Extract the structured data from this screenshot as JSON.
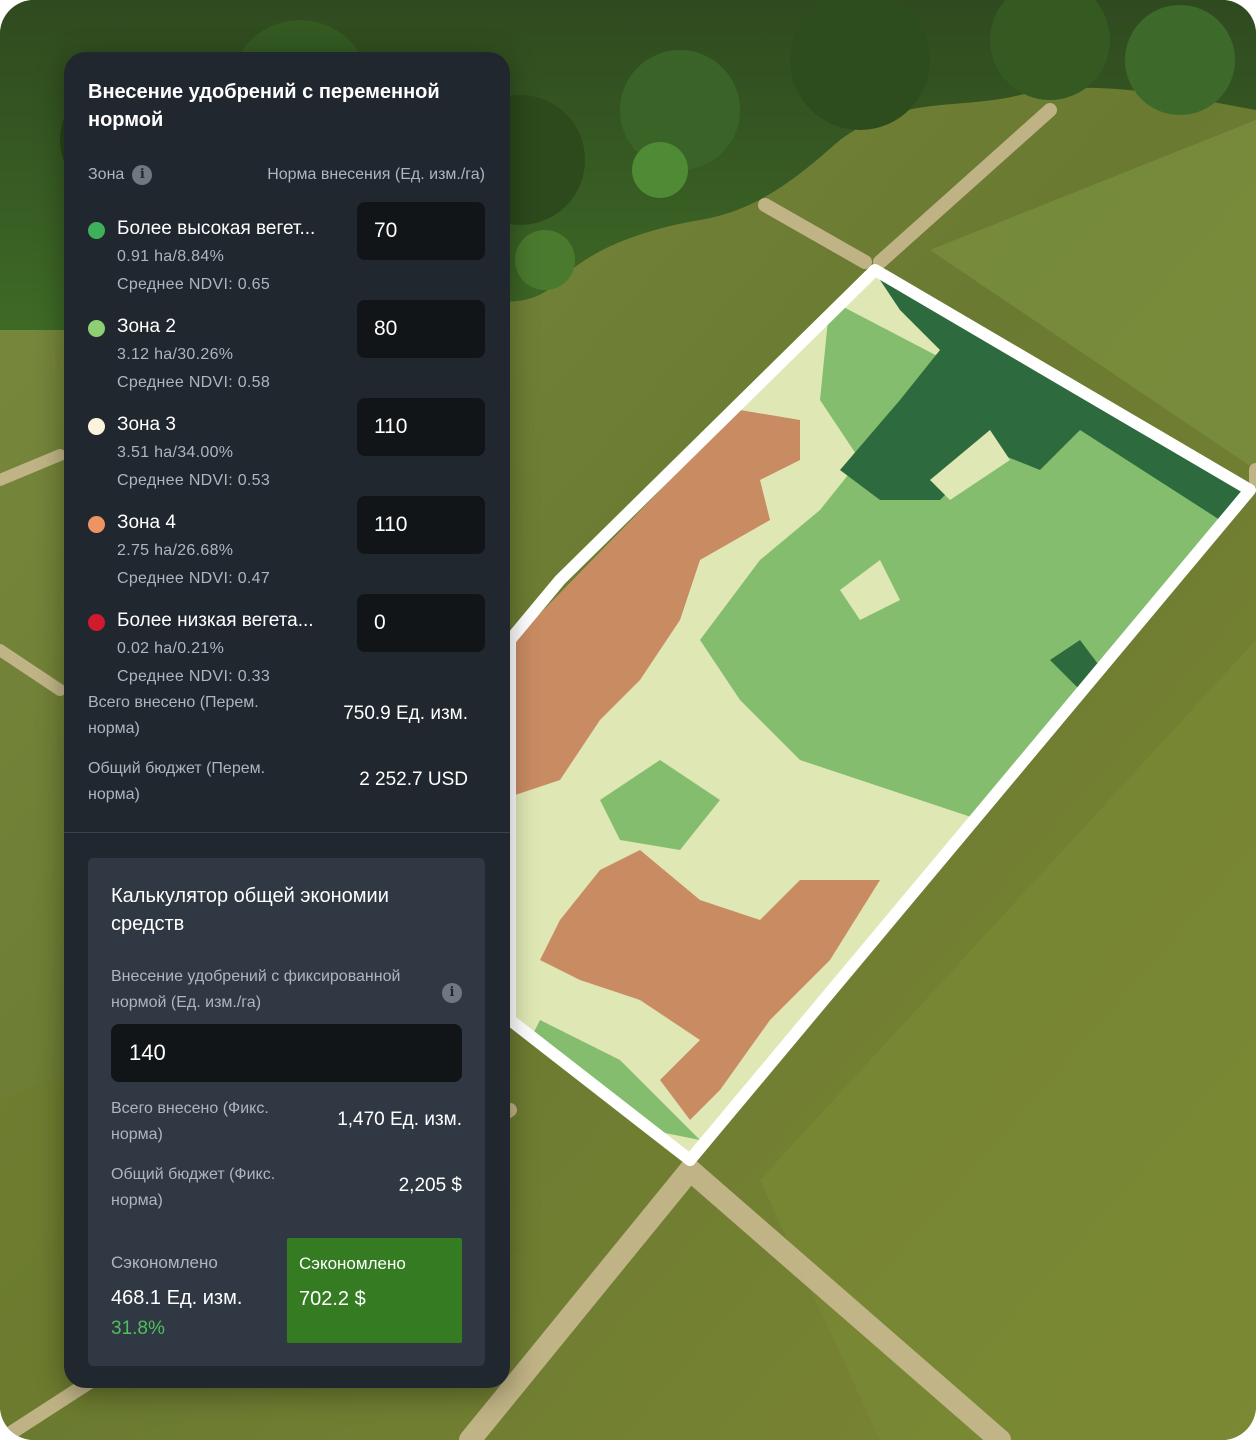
{
  "panel": {
    "title": "Внесение удобрений с переменной нормой",
    "zone_header": "Зона",
    "rate_header": "Норма внесения (Ед. изм./га)",
    "zones": [
      {
        "name": "Более высокая вегет...",
        "area": "0.91 ha/8.84%",
        "ndvi": "Среднее NDVI: 0.65",
        "rate": "70",
        "color": "#3fb05a"
      },
      {
        "name": "Зона 2",
        "area": "3.12 ha/30.26%",
        "ndvi": "Среднее NDVI: 0.58",
        "rate": "80",
        "color": "#8fcf73"
      },
      {
        "name": "Зона 3",
        "area": "3.51 ha/34.00%",
        "ndvi": "Среднее NDVI: 0.53",
        "rate": "110",
        "color": "#fbf3dc"
      },
      {
        "name": "Зона 4",
        "area": "2.75 ha/26.68%",
        "ndvi": "Среднее NDVI: 0.47",
        "rate": "110",
        "color": "#ec9563"
      },
      {
        "name": "Более низкая вегета...",
        "area": "0.02 ha/0.21%",
        "ndvi": "Среднее NDVI: 0.33",
        "rate": "0",
        "color": "#cf1b2d"
      }
    ],
    "total_applied_label": "Всего внесено (Перем. норма)",
    "total_applied_value": "750.9 Ед. изм.",
    "total_budget_label": "Общий бюджет (Перем. норма)",
    "total_budget_value": "2 252.7 USD"
  },
  "calculator": {
    "title": "Калькулятор общей экономии средств",
    "fixed_rate_label": "Внесение удобрений с фиксированной нормой (Ед. изм./га)",
    "fixed_rate_value": "140",
    "total_applied_label": "Всего внесено (Фикс. норма)",
    "total_applied_value": "1,470 Ед. изм.",
    "total_budget_label": "Общий бюджет (Фикс. норма)",
    "total_budget_value": "2,205 $",
    "saved_label": "Сэкономлено",
    "saved_units": "468.1 Ед. изм.",
    "saved_percent": "31.8%",
    "saved_money_label": "Сэкономлено",
    "saved_money": "702.2 $"
  },
  "colors": {
    "panel_bg": "#21272f",
    "card_bg": "#303843",
    "input_bg": "#121518",
    "saved_box": "#357b22",
    "saved_percent": "#4fbf5d",
    "field_outline": "#ffffff"
  }
}
